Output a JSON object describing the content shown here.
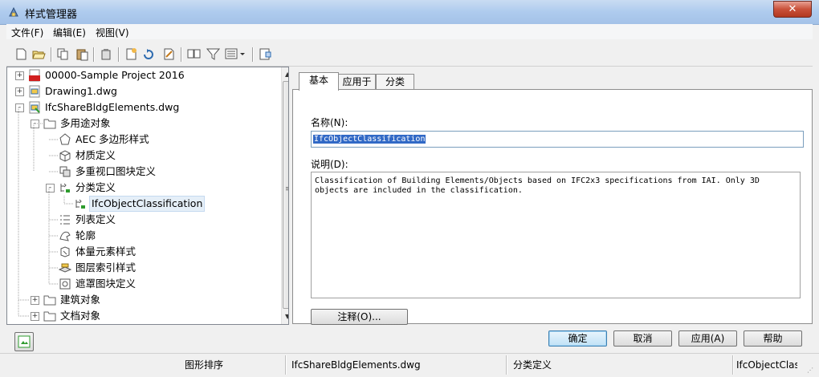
{
  "window": {
    "title": "样式管理器",
    "close_label": "✕"
  },
  "menu": {
    "items": [
      "文件(F)",
      "编辑(E)",
      "视图(V)"
    ]
  },
  "tree": {
    "items": [
      {
        "label": "00000-Sample Project 2016",
        "expander": "+",
        "icon": "acad-file-icon"
      },
      {
        "label": "Drawing1.dwg",
        "expander": "+",
        "icon": "drawing-file-icon"
      },
      {
        "label": "IfcShareBldgElements.dwg",
        "expander": "-",
        "icon": "drawing-file-icon"
      },
      {
        "label": "多用途对象",
        "expander": "-",
        "icon": "folder-icon"
      },
      {
        "label": "AEC 多边形样式",
        "icon": "polygon-icon"
      },
      {
        "label": "材质定义",
        "icon": "material-icon"
      },
      {
        "label": "多重视口图块定义",
        "icon": "mvblock-icon"
      },
      {
        "label": "分类定义",
        "expander": "-",
        "icon": "classification-icon"
      },
      {
        "label": "IfcObjectClassification",
        "icon": "classification-icon"
      },
      {
        "label": "列表定义",
        "icon": "list-icon"
      },
      {
        "label": "轮廓",
        "icon": "profile-icon"
      },
      {
        "label": "体量元素样式",
        "icon": "mass-element-icon"
      },
      {
        "label": "图层索引样式",
        "icon": "layer-key-icon"
      },
      {
        "label": "遮罩图块定义",
        "icon": "mask-block-icon"
      },
      {
        "label": "建筑对象",
        "expander": "+",
        "icon": "folder-icon"
      },
      {
        "label": "文档对象",
        "expander": "+",
        "icon": "folder-icon"
      }
    ]
  },
  "tabs": [
    "基本",
    "应用于",
    "分类"
  ],
  "form": {
    "name_label": "名称(N):",
    "name_value": "IfcObjectClassification",
    "desc_label": "说明(D):",
    "desc_value": "Classification of Building Elements/Objects based on IFC2x3 specifications from IAI. Only 3D objects are included in the classification.",
    "notes_button": "注释(O)..."
  },
  "buttons": {
    "ok": "确定",
    "cancel": "取消",
    "apply": "应用(A)",
    "help": "帮助"
  },
  "status": {
    "sort": "图形排序",
    "file": "IfcShareBldgElements.dwg",
    "category": "分类定义",
    "item": "IfcObjectClassification"
  }
}
